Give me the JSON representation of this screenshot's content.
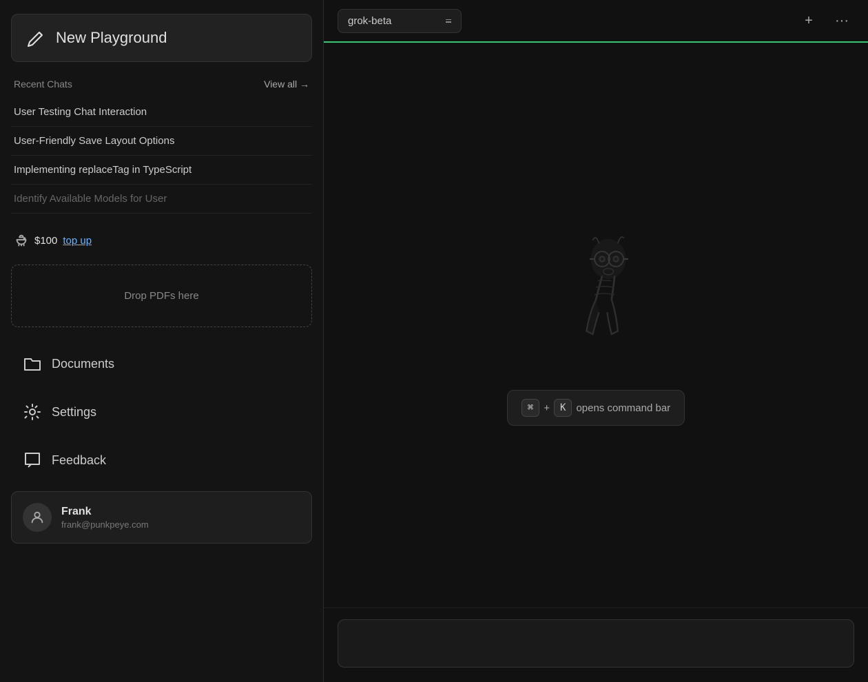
{
  "sidebar": {
    "new_playground_label": "New Playground",
    "recent_chats_label": "Recent Chats",
    "view_all_label": "View all →",
    "chats": [
      {
        "title": "User Testing Chat Interaction"
      },
      {
        "title": "User-Friendly Save Layout Options"
      },
      {
        "title": "Implementing replaceTag in TypeScript"
      },
      {
        "title": "Identify Available Models for User",
        "faded": true
      }
    ],
    "credits_amount": "$100",
    "top_up_label": "top up",
    "drop_zone_label": "Drop PDFs here",
    "nav_items": [
      {
        "key": "documents",
        "label": "Documents"
      },
      {
        "key": "settings",
        "label": "Settings"
      },
      {
        "key": "feedback",
        "label": "Feedback"
      }
    ],
    "user": {
      "name": "Frank",
      "email": "frank@punkpeye.com"
    }
  },
  "main": {
    "model_selector_value": "grok-beta",
    "add_button_label": "+",
    "more_button_label": "···",
    "shortcut": {
      "cmd_key": "⌘",
      "plus": "+",
      "k_key": "K",
      "hint": "opens command bar"
    },
    "input_placeholder": ""
  }
}
